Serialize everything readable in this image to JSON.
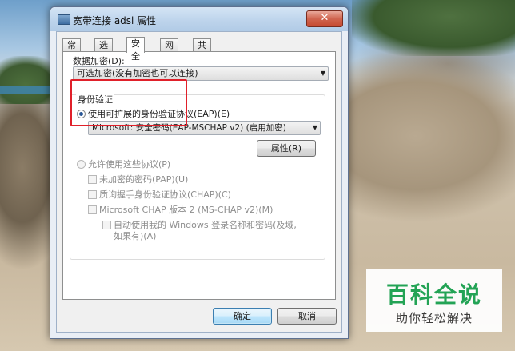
{
  "window": {
    "title": "宽带连接 adsl 属性",
    "close_glyph": "✕"
  },
  "tabs": [
    "常规",
    "选项",
    "安全",
    "网络",
    "共享"
  ],
  "active_tab": "安全",
  "encryption": {
    "label": "数据加密(D):",
    "selected": "可选加密(没有加密也可以连接)"
  },
  "auth": {
    "group_label": "身份验证",
    "eap_radio_label": "使用可扩展的身份验证协议(EAP)(E)",
    "eap_selected": "Microsoft: 安全密码(EAP-MSCHAP v2) (启用加密)",
    "properties_button": "属性(R)",
    "allow_radio_label": "允许使用这些协议(P)",
    "protocols": [
      "未加密的密码(PAP)(U)",
      "质询握手身份验证协议(CHAP)(C)",
      "Microsoft CHAP 版本 2 (MS-CHAP v2)(M)"
    ],
    "auto_logon_line1": "自动使用我的 Windows 登录名称和密码(及域,",
    "auto_logon_line2": "如果有)(A)"
  },
  "buttons": {
    "ok": "确定",
    "cancel": "取消"
  },
  "watermark": {
    "title": "百科全说",
    "subtitle": "助你轻松解决"
  },
  "colors": {
    "highlight_box": "#e0202a",
    "watermark_green": "#1aa251"
  }
}
